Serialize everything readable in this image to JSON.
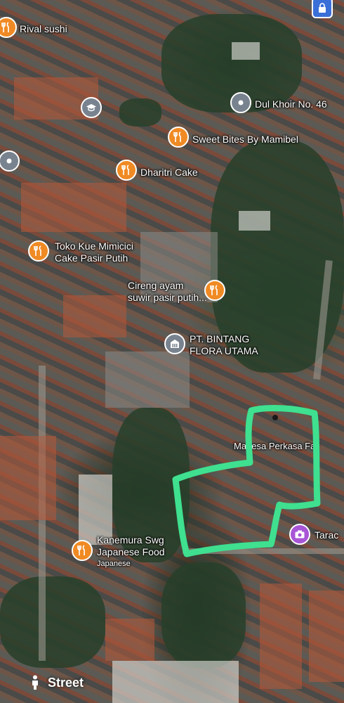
{
  "map": {
    "places": [
      {
        "name": "Rival sushi",
        "icon": "food-icon",
        "color": "#f08a24"
      },
      {
        "name": "Dul Khoir No. 46",
        "icon": "place-pin-icon",
        "color": "#78838f"
      },
      {
        "name": "Sweet Bites By Mamibel",
        "icon": "food-icon",
        "color": "#f08a24"
      },
      {
        "name": "Dharitri Cake",
        "icon": "food-icon",
        "color": "#f08a24"
      },
      {
        "name": "Toko Kue Mimicici",
        "name2": "Cake Pasir Putih",
        "icon": "food-icon",
        "color": "#f08a24"
      },
      {
        "name": "Cireng ayam",
        "name2": "suwir pasir putih...",
        "icon": "food-icon",
        "color": "#f08a24"
      },
      {
        "name": "PT. BINTANG",
        "name2": "FLORA UTAMA",
        "icon": "building-icon",
        "color": "#78838f"
      },
      {
        "name": "Mahesa Perkasa Far",
        "icon": "",
        "color": ""
      },
      {
        "name": "Kanemura Swg",
        "name2": "Japanese Food",
        "category": "Japanese",
        "icon": "food-icon",
        "color": "#f08a24"
      },
      {
        "name": "Tarac",
        "icon": "camera-icon",
        "color": "#a855d6"
      }
    ],
    "unlabeled_pins": [
      {
        "icon": "school-icon"
      },
      {
        "icon": "place-pin-icon"
      },
      {
        "icon": "lock-icon"
      }
    ],
    "drawn_outline_color": "#3fe08f"
  },
  "controls": {
    "street_label": "Street"
  }
}
